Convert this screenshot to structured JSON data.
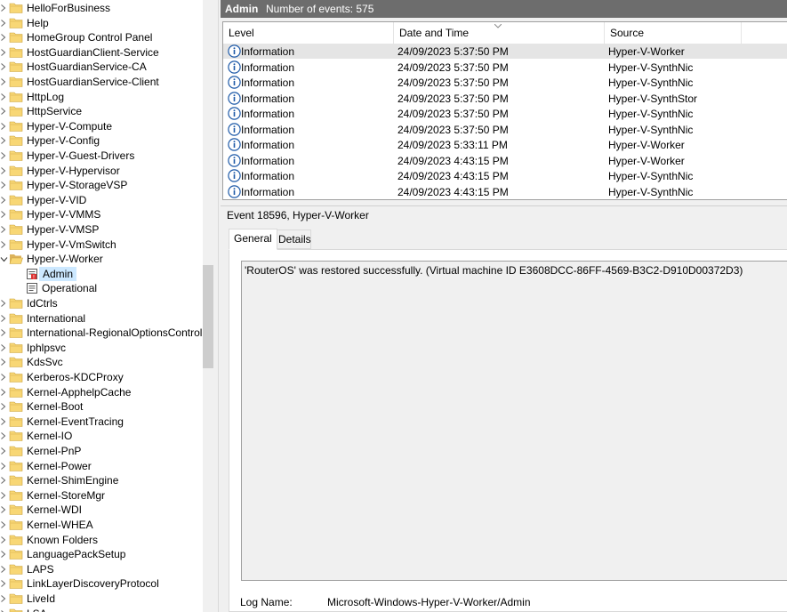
{
  "tree": {
    "items": [
      {
        "label": "HelloForBusiness",
        "kind": "folder"
      },
      {
        "label": "Help",
        "kind": "folder"
      },
      {
        "label": "HomeGroup Control Panel",
        "kind": "folder"
      },
      {
        "label": "HostGuardianClient-Service",
        "kind": "folder"
      },
      {
        "label": "HostGuardianService-CA",
        "kind": "folder"
      },
      {
        "label": "HostGuardianService-Client",
        "kind": "folder"
      },
      {
        "label": "HttpLog",
        "kind": "folder"
      },
      {
        "label": "HttpService",
        "kind": "folder"
      },
      {
        "label": "Hyper-V-Compute",
        "kind": "folder"
      },
      {
        "label": "Hyper-V-Config",
        "kind": "folder"
      },
      {
        "label": "Hyper-V-Guest-Drivers",
        "kind": "folder"
      },
      {
        "label": "Hyper-V-Hypervisor",
        "kind": "folder"
      },
      {
        "label": "Hyper-V-StorageVSP",
        "kind": "folder"
      },
      {
        "label": "Hyper-V-VID",
        "kind": "folder"
      },
      {
        "label": "Hyper-V-VMMS",
        "kind": "folder"
      },
      {
        "label": "Hyper-V-VMSP",
        "kind": "folder"
      },
      {
        "label": "Hyper-V-VmSwitch",
        "kind": "folder"
      },
      {
        "label": "Hyper-V-Worker",
        "kind": "folder-open"
      },
      {
        "label": "Admin",
        "kind": "log-selected"
      },
      {
        "label": "Operational",
        "kind": "log"
      },
      {
        "label": "IdCtrls",
        "kind": "folder"
      },
      {
        "label": "International",
        "kind": "folder"
      },
      {
        "label": "International-RegionalOptionsControlPa",
        "kind": "folder"
      },
      {
        "label": "Iphlpsvc",
        "kind": "folder"
      },
      {
        "label": "KdsSvc",
        "kind": "folder"
      },
      {
        "label": "Kerberos-KDCProxy",
        "kind": "folder"
      },
      {
        "label": "Kernel-ApphelpCache",
        "kind": "folder"
      },
      {
        "label": "Kernel-Boot",
        "kind": "folder"
      },
      {
        "label": "Kernel-EventTracing",
        "kind": "folder"
      },
      {
        "label": "Kernel-IO",
        "kind": "folder"
      },
      {
        "label": "Kernel-PnP",
        "kind": "folder"
      },
      {
        "label": "Kernel-Power",
        "kind": "folder"
      },
      {
        "label": "Kernel-ShimEngine",
        "kind": "folder"
      },
      {
        "label": "Kernel-StoreMgr",
        "kind": "folder"
      },
      {
        "label": "Kernel-WDI",
        "kind": "folder"
      },
      {
        "label": "Kernel-WHEA",
        "kind": "folder"
      },
      {
        "label": "Known Folders",
        "kind": "folder"
      },
      {
        "label": "LanguagePackSetup",
        "kind": "folder"
      },
      {
        "label": "LAPS",
        "kind": "folder"
      },
      {
        "label": "LinkLayerDiscoveryProtocol",
        "kind": "folder"
      },
      {
        "label": "LiveId",
        "kind": "folder"
      },
      {
        "label": "LSA",
        "kind": "folder"
      }
    ]
  },
  "header": {
    "title": "Admin",
    "count_text": "Number of events: 575"
  },
  "events": {
    "columns": [
      "Level",
      "Date and Time",
      "Source"
    ],
    "rows": [
      {
        "level": "Information",
        "datetime": "24/09/2023 5:37:50 PM",
        "source": "Hyper-V-Worker"
      },
      {
        "level": "Information",
        "datetime": "24/09/2023 5:37:50 PM",
        "source": "Hyper-V-SynthNic"
      },
      {
        "level": "Information",
        "datetime": "24/09/2023 5:37:50 PM",
        "source": "Hyper-V-SynthNic"
      },
      {
        "level": "Information",
        "datetime": "24/09/2023 5:37:50 PM",
        "source": "Hyper-V-SynthStor"
      },
      {
        "level": "Information",
        "datetime": "24/09/2023 5:37:50 PM",
        "source": "Hyper-V-SynthNic"
      },
      {
        "level": "Information",
        "datetime": "24/09/2023 5:37:50 PM",
        "source": "Hyper-V-SynthNic"
      },
      {
        "level": "Information",
        "datetime": "24/09/2023 5:33:11 PM",
        "source": "Hyper-V-Worker"
      },
      {
        "level": "Information",
        "datetime": "24/09/2023 4:43:15 PM",
        "source": "Hyper-V-Worker"
      },
      {
        "level": "Information",
        "datetime": "24/09/2023 4:43:15 PM",
        "source": "Hyper-V-SynthNic"
      },
      {
        "level": "Information",
        "datetime": "24/09/2023 4:43:15 PM",
        "source": "Hyper-V-SynthNic"
      }
    ]
  },
  "detail": {
    "title": "Event 18596, Hyper-V-Worker",
    "tabs": [
      "General",
      "Details"
    ],
    "description": "'RouterOS' was restored successfully. (Virtual machine ID E3608DCC-86FF-4569-B3C2-D910D00372D3)",
    "log_name_label": "Log Name:",
    "log_name_value": "Microsoft-Windows-Hyper-V-Worker/Admin"
  },
  "colors": {
    "header_bar": "#6d6d6d",
    "selection": "#cce8ff",
    "folder": "#f8d775",
    "info_icon": "#1e5aa8"
  }
}
